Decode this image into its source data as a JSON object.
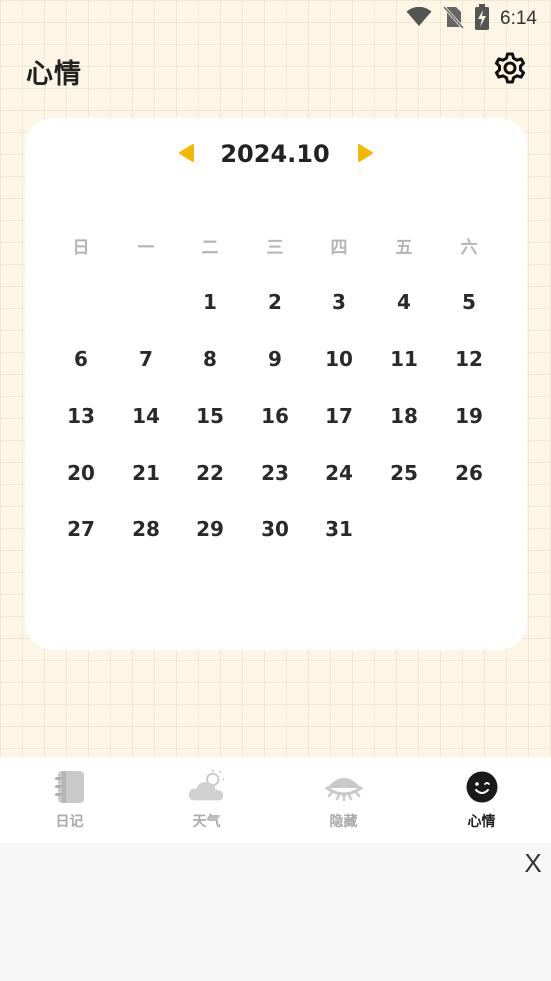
{
  "status_bar": {
    "time": "6:14",
    "icons": [
      "wifi-icon",
      "no-sim-icon",
      "battery-charging-icon"
    ]
  },
  "header": {
    "title": "心情",
    "settings_icon": "gear-icon"
  },
  "calendar": {
    "month_label": "2024.10",
    "accent_color": "#f5b800",
    "weekdays": [
      "日",
      "一",
      "二",
      "三",
      "四",
      "五",
      "六"
    ],
    "weeks": [
      [
        "",
        "",
        "1",
        "2",
        "3",
        "4",
        "5"
      ],
      [
        "6",
        "7",
        "8",
        "9",
        "10",
        "11",
        "12"
      ],
      [
        "13",
        "14",
        "15",
        "16",
        "17",
        "18",
        "19"
      ],
      [
        "20",
        "21",
        "22",
        "23",
        "24",
        "25",
        "26"
      ],
      [
        "27",
        "28",
        "29",
        "30",
        "31",
        "",
        ""
      ]
    ]
  },
  "bottom_nav": {
    "tabs": [
      {
        "label": "日记",
        "icon": "notebook-icon",
        "active": false
      },
      {
        "label": "天气",
        "icon": "cloud-sun-icon",
        "active": false
      },
      {
        "label": "隐藏",
        "icon": "closed-eye-icon",
        "active": false
      },
      {
        "label": "心情",
        "icon": "smiley-face-icon",
        "active": true
      }
    ]
  },
  "ad": {
    "close_label": "X"
  }
}
